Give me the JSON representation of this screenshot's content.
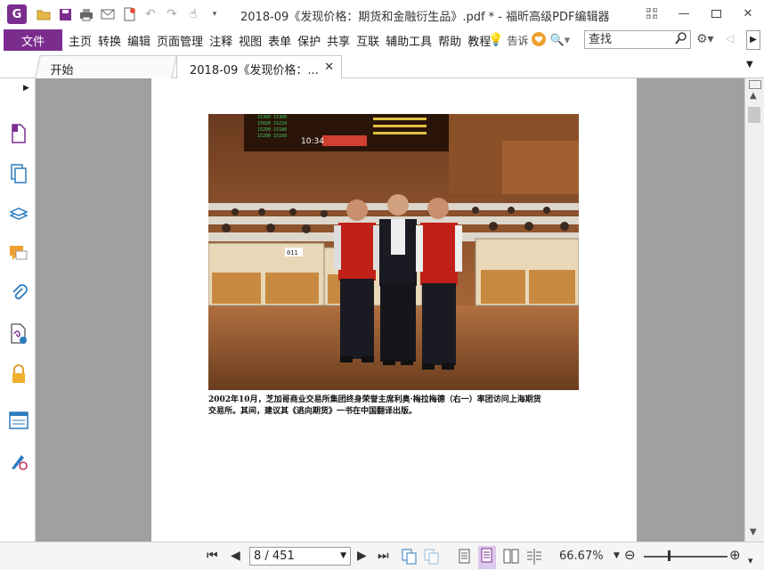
{
  "app": {
    "logo_letter": "G",
    "window_title": "2018-09《发现价格：期货和金融衍生品》.pdf * - 福昕高级PDF编辑器"
  },
  "menu": {
    "file": "文件",
    "items": [
      "主页",
      "转换",
      "编辑",
      "页面管理",
      "注释",
      "视图",
      "表单",
      "保护",
      "共享",
      "互联",
      "辅助工具",
      "帮助",
      "教程"
    ],
    "tell_me": "告诉",
    "search_placeholder": "查找"
  },
  "tabs": [
    {
      "label": "开始"
    },
    {
      "label": "2018-09《发现价格：..."
    }
  ],
  "document": {
    "caption_line1": "2002年10月，芝加哥商业交易所集团终身荣誉主席利奥·梅拉梅德（右一）率团访问上海期货",
    "caption_line2": "交易所。其间，建议其《逃向期货》一书在中国翻译出版。",
    "board_time": "10:34",
    "desk_number": "011"
  },
  "status": {
    "page_field": "8 / 451",
    "zoom": "66.67%"
  },
  "colors": {
    "brand": "#7b2d8e",
    "doc_background": "#a0a0a0"
  }
}
